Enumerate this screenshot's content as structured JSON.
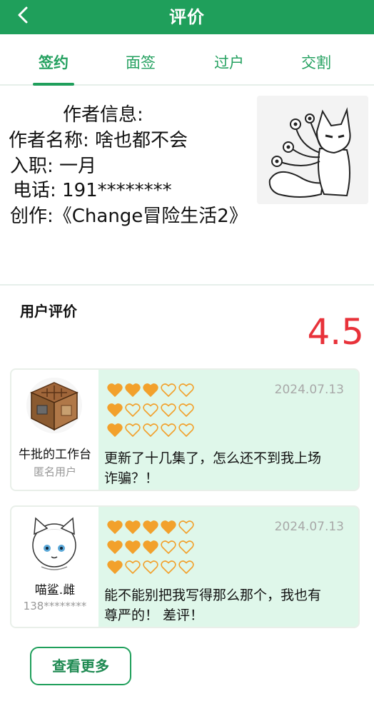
{
  "header": {
    "title": "评价",
    "back_icon": "chevron-left-icon"
  },
  "tabs": [
    {
      "label": "签约",
      "active": true
    },
    {
      "label": "面签",
      "active": false
    },
    {
      "label": "过户",
      "active": false
    },
    {
      "label": "交割",
      "active": false
    }
  ],
  "author": {
    "heading": "作者信息:",
    "name_line": "作者名称: 啥也都不会",
    "join_line": "入职: 一月",
    "phone_line": "电话: 191********",
    "work_line": "创作:《Change冒险生活2》"
  },
  "reviews": {
    "title": "用户评价",
    "score": "4.5",
    "items": [
      {
        "username": "牛批的工作台",
        "subtitle": "匿名用户",
        "date": "2024.07.13",
        "heart_rows": [
          3,
          1,
          1
        ],
        "comment_line1": "更新了十几集了，怎么还不到我上场",
        "comment_line2": "诈骗？！"
      },
      {
        "username": "喵鲨.雌",
        "subtitle": "138********",
        "date": "2024.07.13",
        "heart_rows": [
          4,
          3,
          1
        ],
        "comment_line1": "能不能别把我写得那么那个，我也有",
        "comment_line2": "尊严的！ 差评！"
      }
    ]
  },
  "more_button": "查看更多",
  "colors": {
    "brand": "#1f9f5b",
    "rating": "#e8323a",
    "heart": "#f2a12c",
    "card_bg": "#dff7ea"
  }
}
